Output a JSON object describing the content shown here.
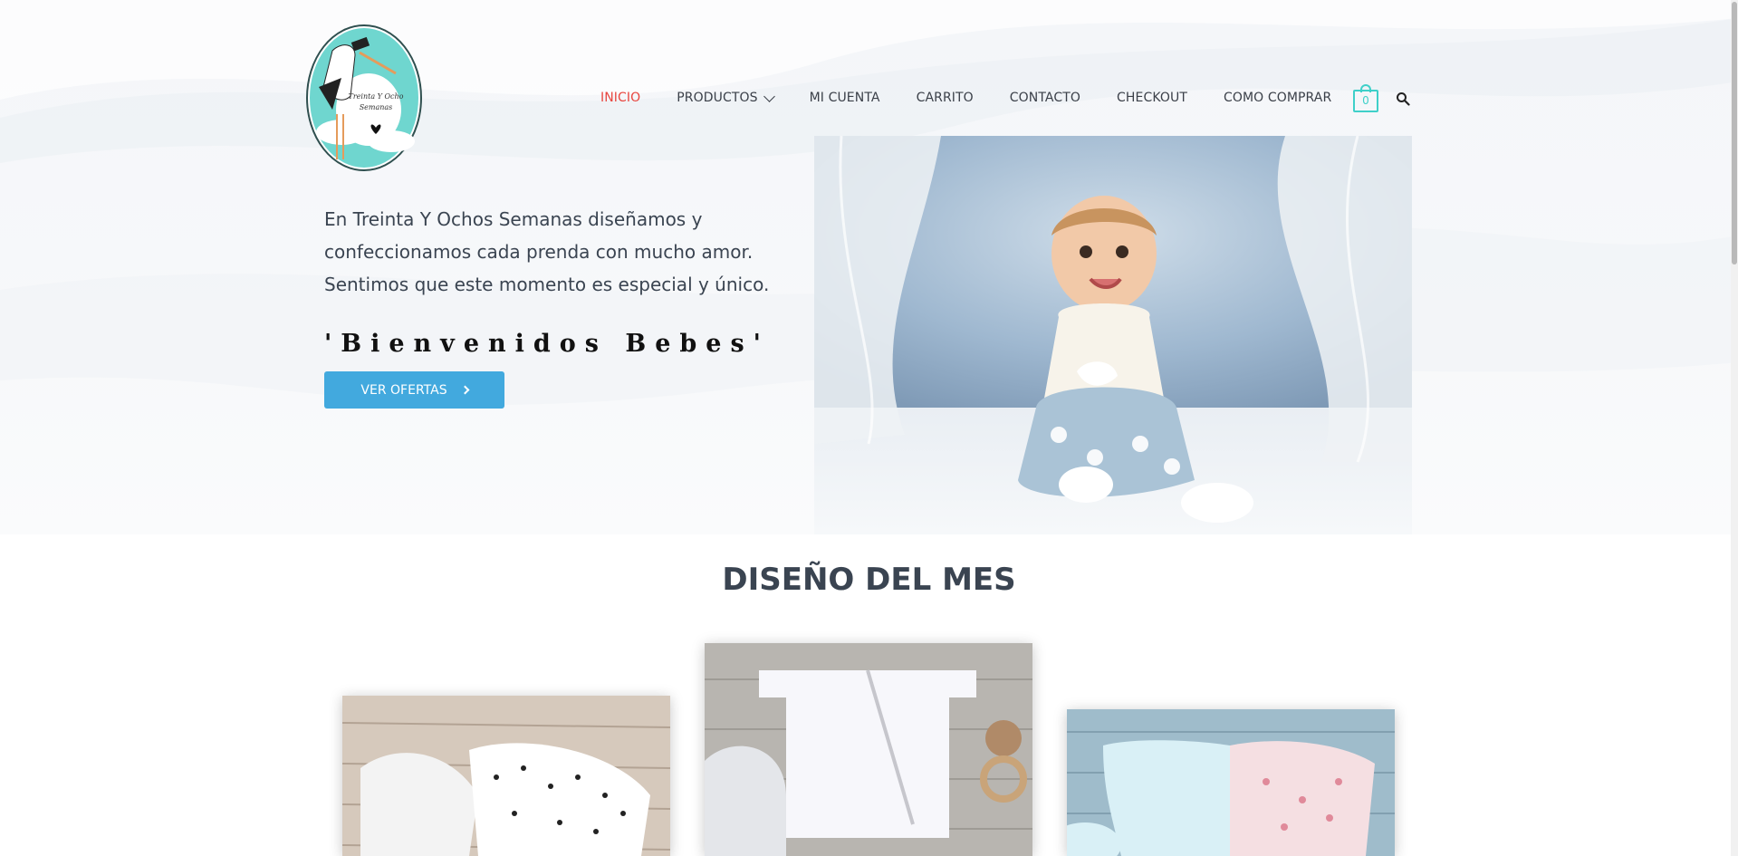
{
  "logo": {
    "text_line1": "Treinta Y Ocho",
    "text_line2": "Semanas"
  },
  "nav": {
    "items": [
      {
        "label": "INICIO"
      },
      {
        "label": "PRODUCTOS"
      },
      {
        "label": "MI CUENTA"
      },
      {
        "label": "CARRITO"
      },
      {
        "label": "CONTACTO"
      },
      {
        "label": "CHECKOUT"
      },
      {
        "label": "COMO COMPRAR"
      }
    ],
    "cart_count": "0"
  },
  "hero": {
    "text_line1": "En Treinta Y Ochos  Semanas diseñamos y",
    "text_line2": "confeccionamos cada prenda con mucho amor.",
    "text_line3": "Sentimos que este momento es especial y único.",
    "heading": "'Bienvenidos Bebes'",
    "cta_label": "VER OFERTAS"
  },
  "section": {
    "title": "DISEÑO DEL MES"
  },
  "colors": {
    "accent": "#42a9de",
    "active_nav": "#e8463f",
    "cart": "#3fd0c9",
    "heading_text": "#3a4451"
  }
}
